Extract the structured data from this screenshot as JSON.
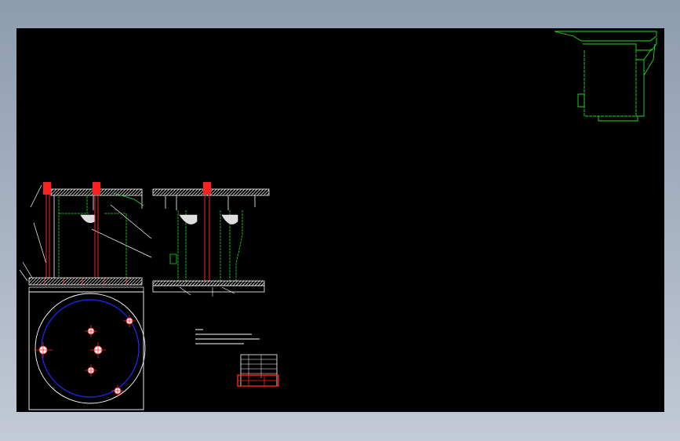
{
  "viewer": {
    "background": "#000000",
    "frame_gradient": [
      "#8e9cb0",
      "#c3cad6"
    ]
  },
  "colors": {
    "outline": "#ffffff",
    "shaft": "#ff2020",
    "body": "#22dd22",
    "circle": "#1a2cff",
    "hatch": "#cccccc"
  },
  "drawing": {
    "views": [
      {
        "name": "front-section-view"
      },
      {
        "name": "side-section-view"
      },
      {
        "name": "top-plan-view"
      },
      {
        "name": "detail-iso-view"
      }
    ],
    "notes_block": {
      "lines": [
        "",
        "",
        "",
        ""
      ]
    },
    "title_block": {
      "rows": [
        "",
        "",
        "",
        "",
        "",
        ""
      ]
    }
  }
}
